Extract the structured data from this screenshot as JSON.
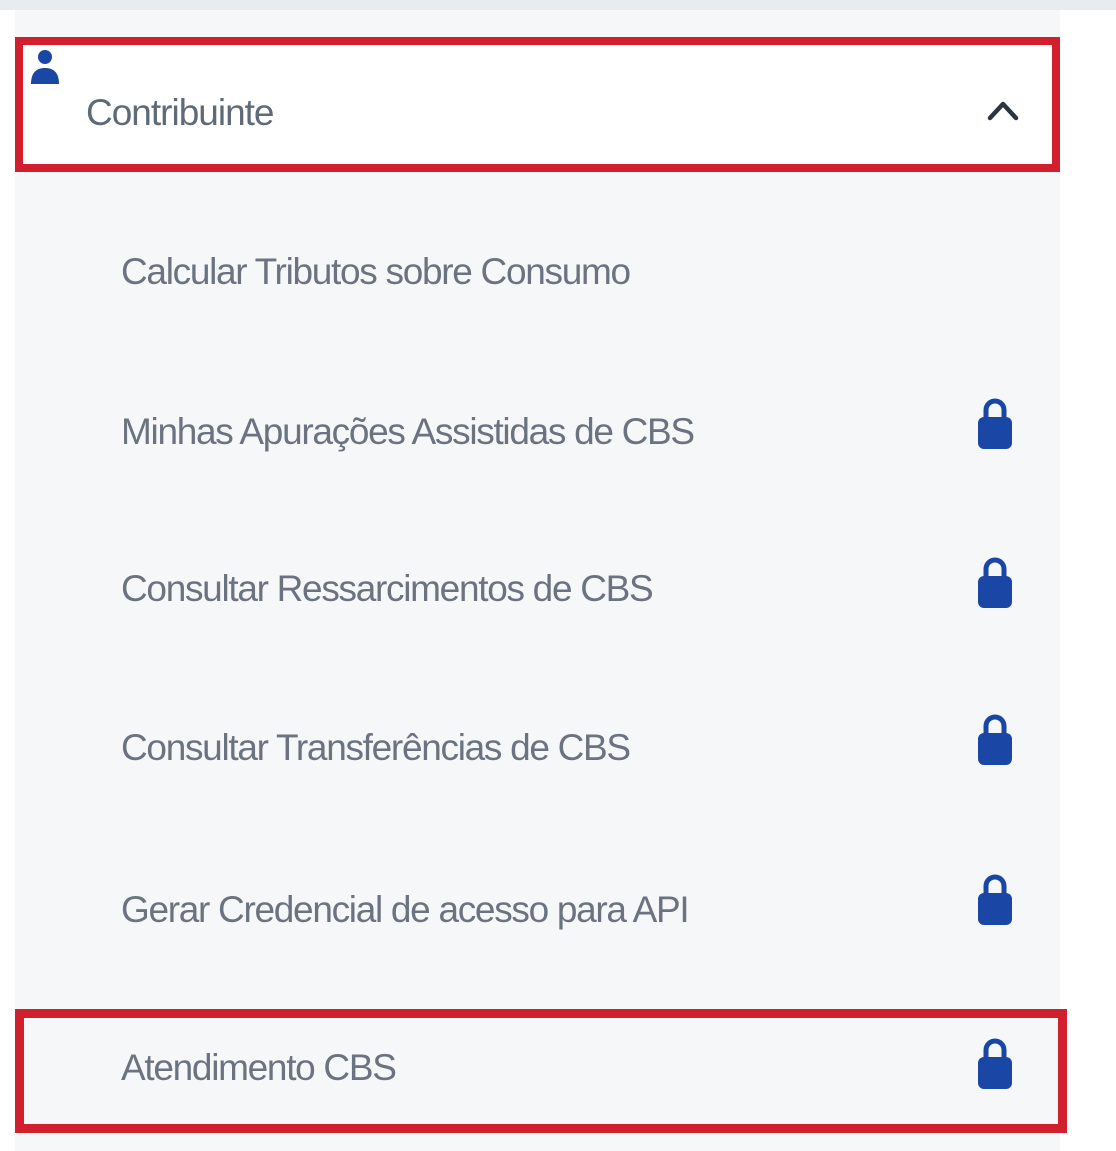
{
  "menu": {
    "section_title": "Contribuinte",
    "section_icon": "user-icon",
    "expand_icon": "chevron-up-icon",
    "items": [
      {
        "label": "Calcular Tributos sobre Consumo",
        "locked": false
      },
      {
        "label": "Minhas Apurações Assistidas de CBS",
        "locked": true,
        "icon": "lock-icon"
      },
      {
        "label": "Consultar Ressarcimentos de CBS",
        "locked": true,
        "icon": "lock-icon"
      },
      {
        "label": "Consultar Transferências de CBS",
        "locked": true,
        "icon": "lock-icon"
      },
      {
        "label": "Gerar Credencial de acesso para API",
        "locked": true,
        "icon": "lock-icon"
      },
      {
        "label": "Atendimento CBS",
        "locked": true,
        "icon": "lock-icon"
      }
    ]
  },
  "colors": {
    "highlight_outline": "#d21f2e",
    "icon_blue": "#1a47a5",
    "text_gray": "#6b7380",
    "panel_background": "#f6f7f8"
  }
}
